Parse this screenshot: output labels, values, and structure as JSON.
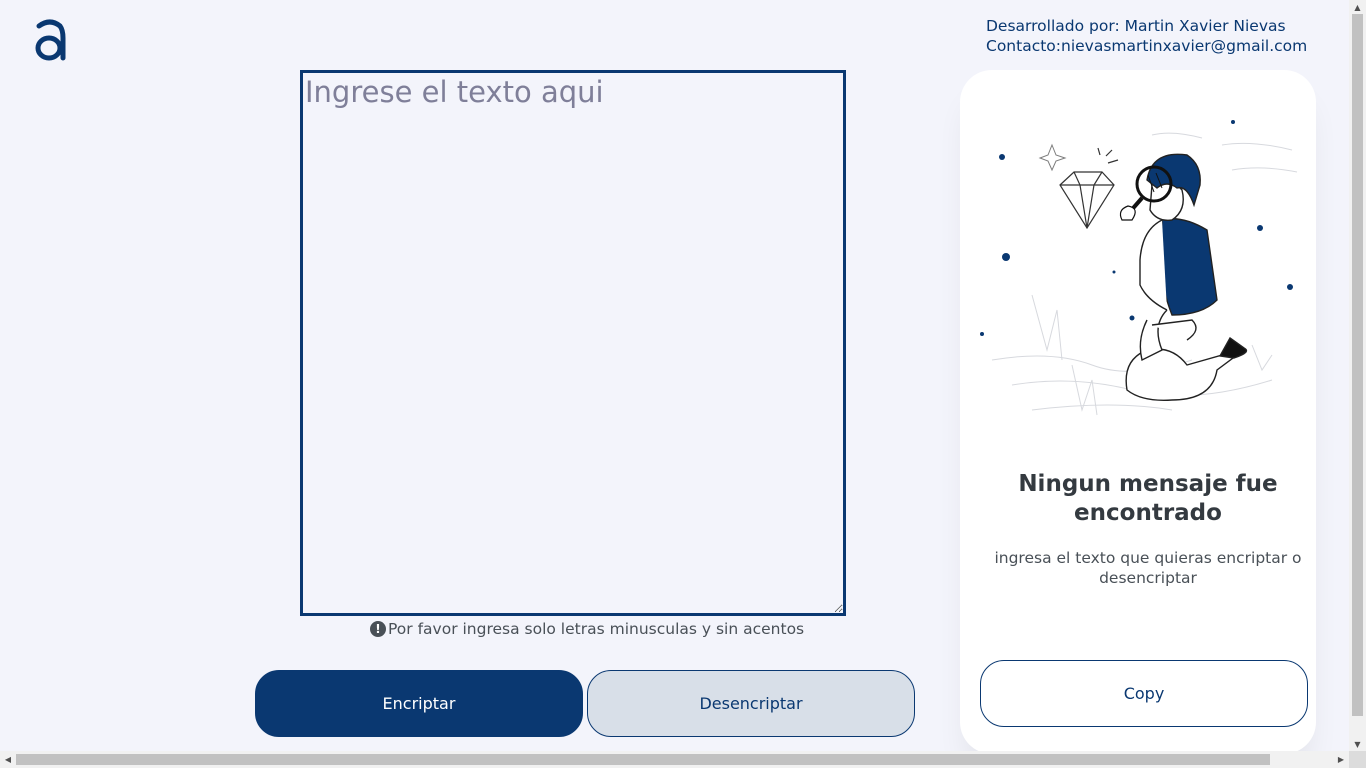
{
  "header": {
    "logo_icon": "alura-a-logo-icon",
    "developer": "Desarrollado por: Martin Xavier Nievas",
    "contact": "Contacto:nievasmartinxavier@gmail.com"
  },
  "editor": {
    "placeholder": "Ingrese el texto aqui",
    "value": "",
    "hint_icon": "exclamation-circle-icon",
    "hint_icon_glyph": "!",
    "hint": "Por favor ingresa solo letras minusculas y sin acentos"
  },
  "actions": {
    "encrypt_label": "Encriptar",
    "decrypt_label": "Desencriptar"
  },
  "output": {
    "illustration": "person-with-magnifying-glass-illustration",
    "title": "Ningun mensaje fue encontrado",
    "subtitle": "ingresa el texto que quieras encriptar o desencriptar",
    "copy_label": "Copy"
  },
  "colors": {
    "primary": "#0a3871",
    "background": "#f3f4fb",
    "secondary_button": "#d8dfe8",
    "panel": "#ffffff"
  }
}
